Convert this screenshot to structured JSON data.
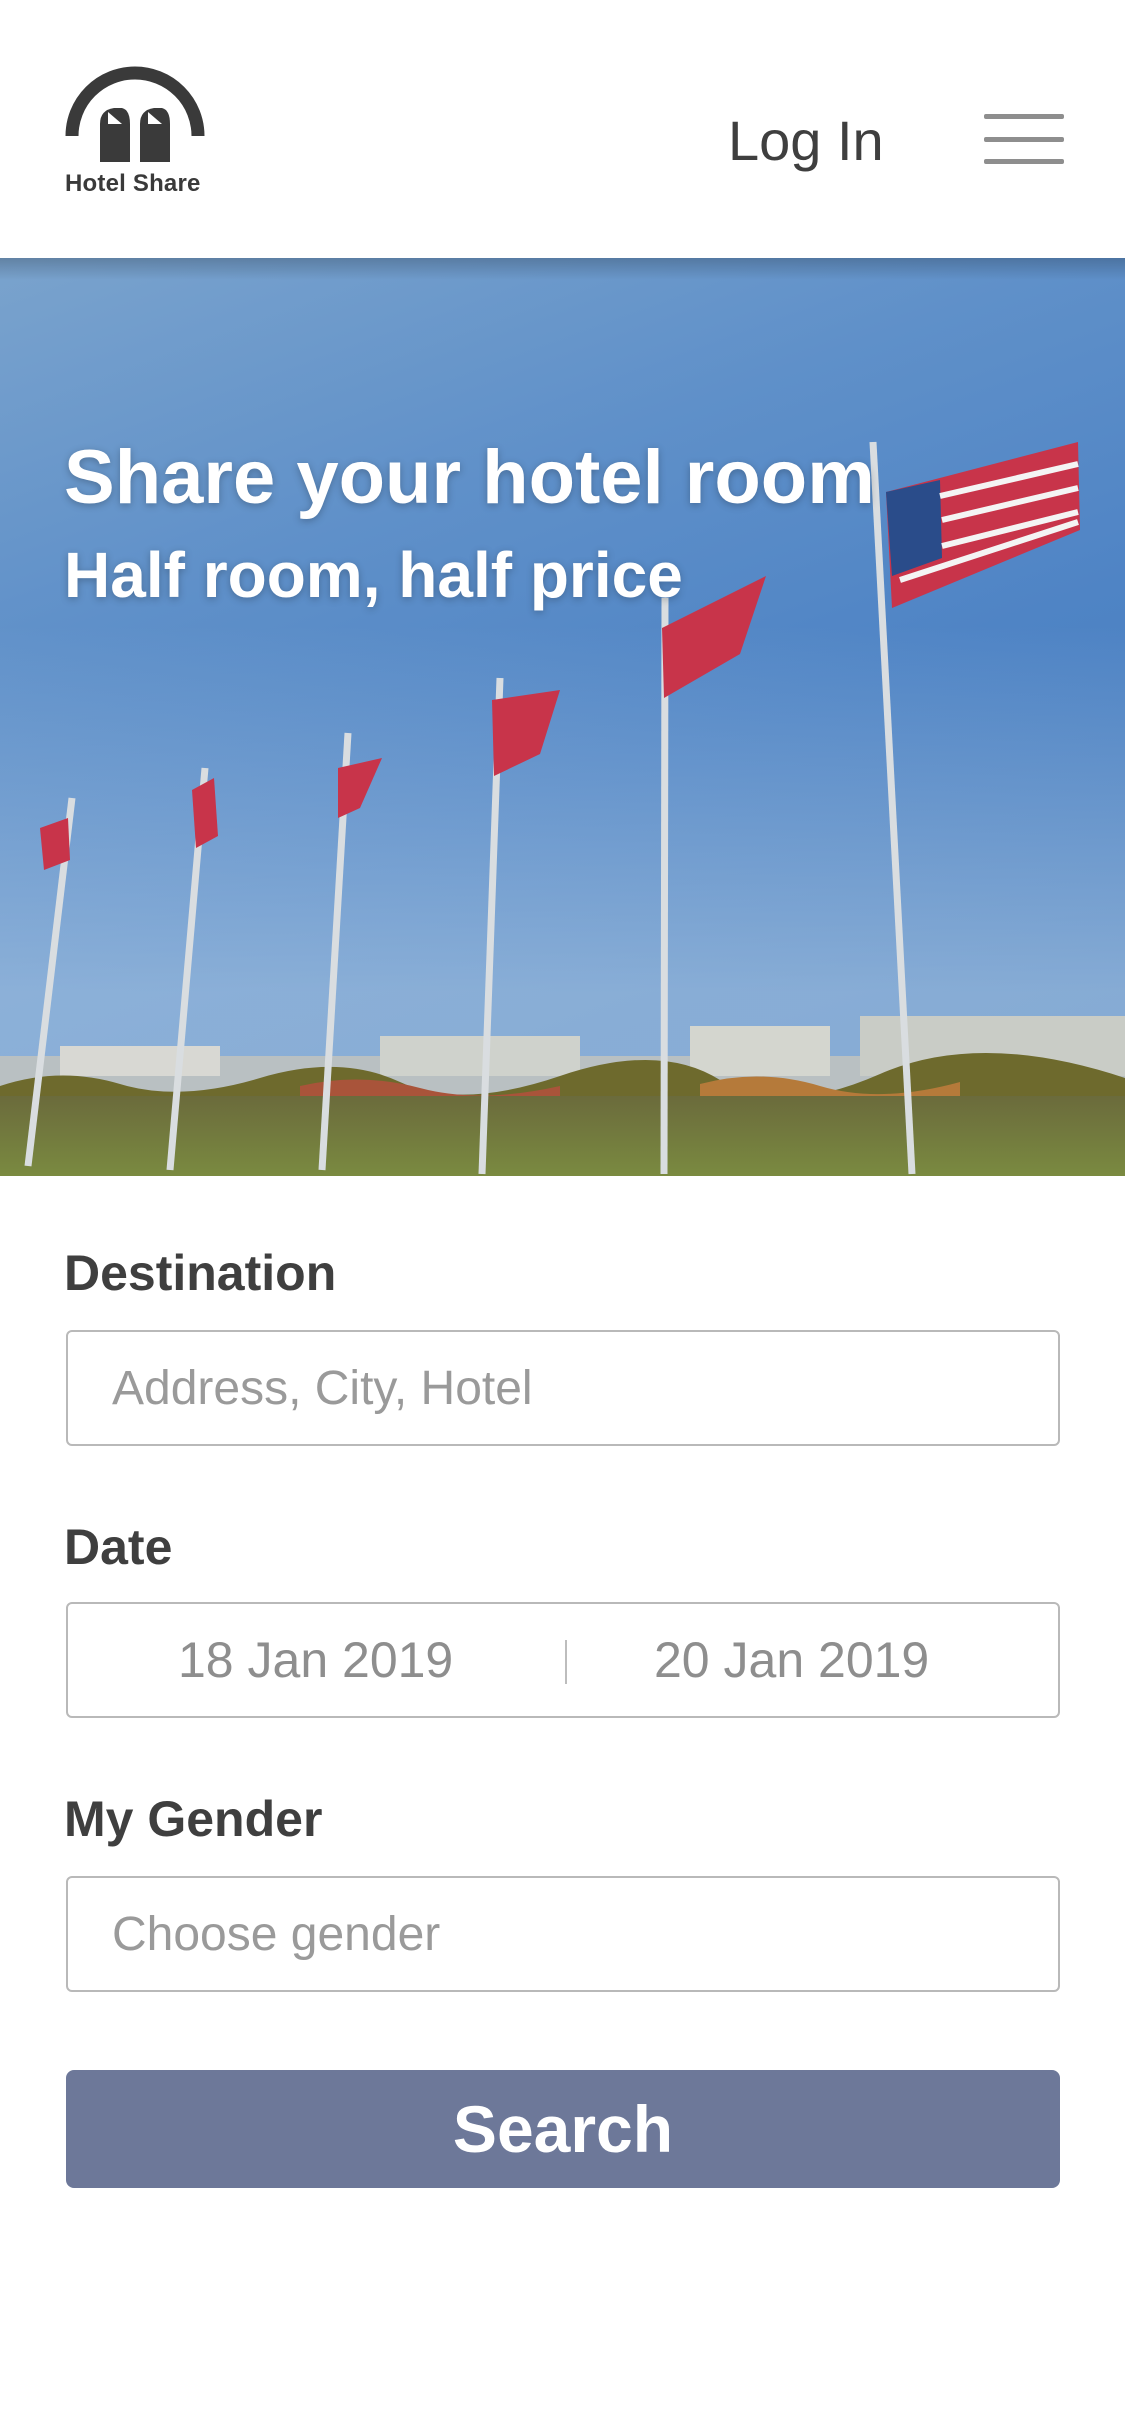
{
  "header": {
    "brand": "Hotel Share",
    "login_label": "Log In",
    "menu_icon": "hamburger-icon"
  },
  "hero": {
    "headline": "Share your hotel room",
    "subheadline": "Half room, half price"
  },
  "form": {
    "destination": {
      "label": "Destination",
      "placeholder": "Address, City, Hotel"
    },
    "date": {
      "label": "Date",
      "start": "18 Jan 2019",
      "end": "20 Jan 2019"
    },
    "gender": {
      "label": "My Gender",
      "placeholder": "Choose gender"
    },
    "search_label": "Search"
  },
  "colors": {
    "button": "#6d7899",
    "text": "#3f3f3f",
    "border": "#b9b9b9"
  }
}
